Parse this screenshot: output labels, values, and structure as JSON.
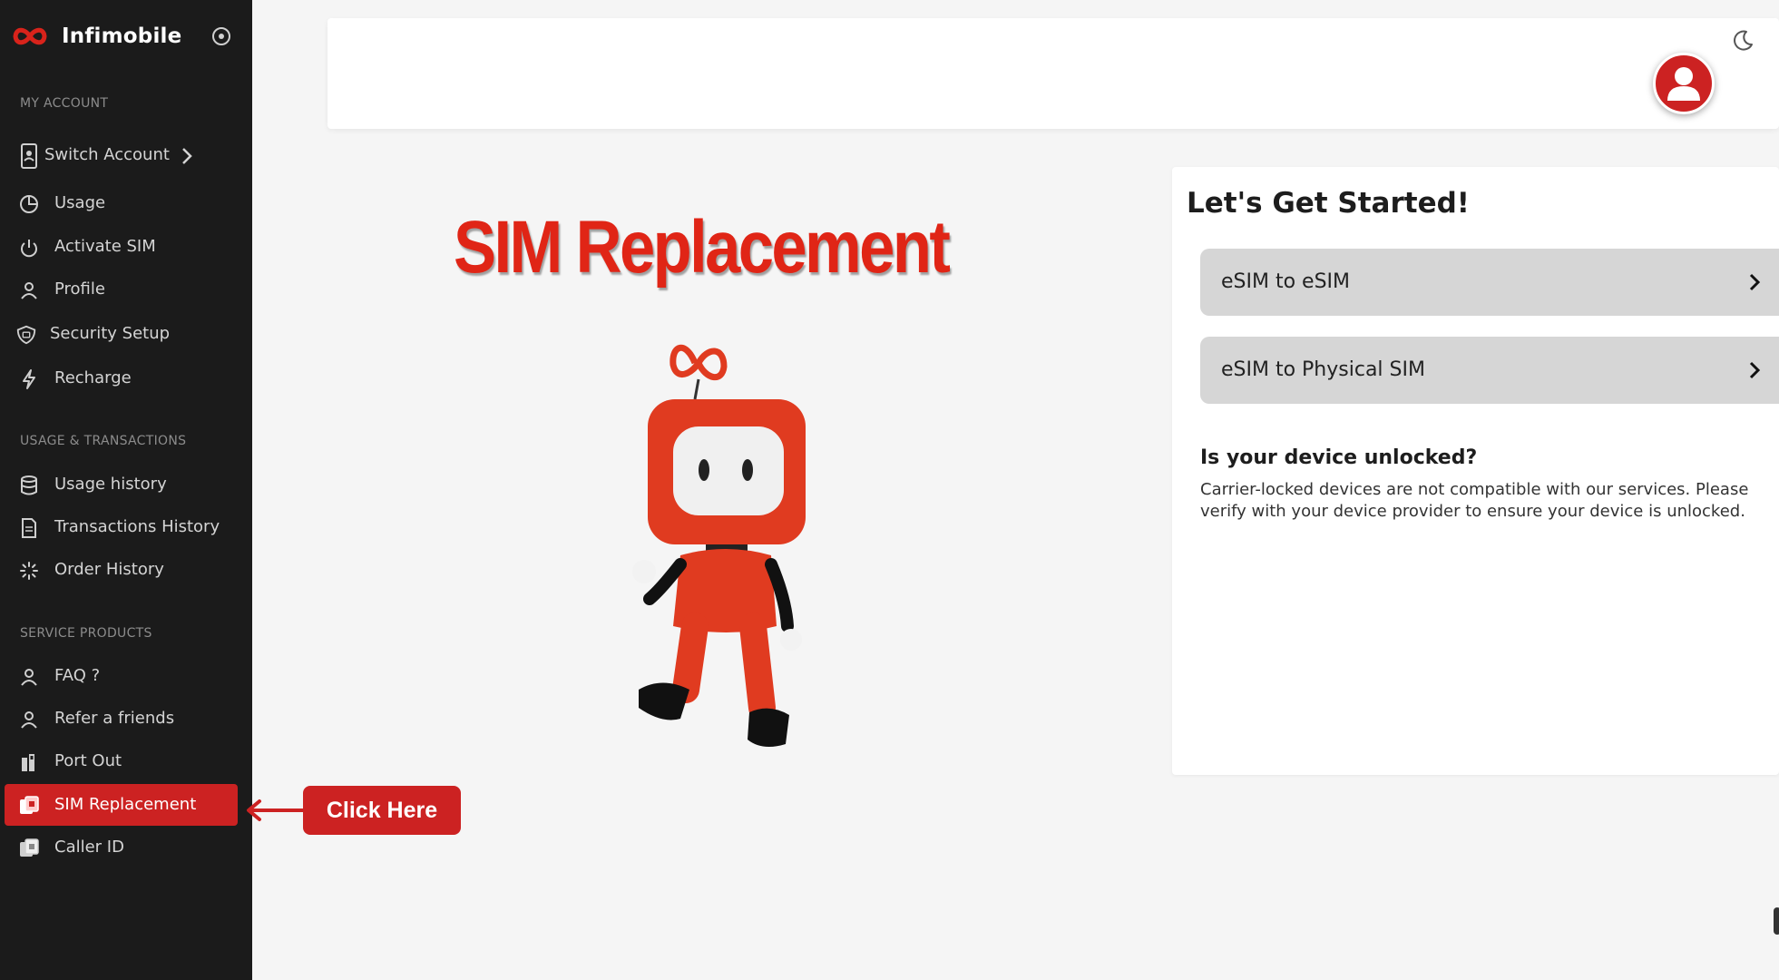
{
  "brand": {
    "name": "Infimobile"
  },
  "sidebar": {
    "sections": {
      "my_account": "MY ACCOUNT",
      "usage_transactions": "USAGE & TRANSACTIONS",
      "service_products": "SERVICE PRODUCTS"
    },
    "switch_account": "Switch Account",
    "items": {
      "usage": "Usage",
      "activate_sim": "Activate SIM",
      "profile": "Profile",
      "security_setup": "Security Setup",
      "recharge": "Recharge",
      "usage_history": "Usage history",
      "transactions_history": "Transactions History",
      "order_history": "Order History",
      "faq": "FAQ ?",
      "refer": "Refer a friends",
      "port_out": "Port Out",
      "sim_replacement": "SIM Replacement",
      "caller_id": "Caller ID"
    },
    "active_item": "SIM Replacement"
  },
  "hero": {
    "title": "SIM Replacement"
  },
  "card": {
    "title": "Let's Get Started!",
    "options": [
      "eSIM to eSIM",
      "eSIM to Physical SIM"
    ],
    "question_title": "Is your device unlocked?",
    "question_text": "Carrier-locked devices are not compatible with our services. Please verify with your device provider to ensure your device is unlocked."
  },
  "callout": {
    "label": "Click Here"
  },
  "colors": {
    "accent": "#cc2222",
    "sidebar_bg": "#1b1b1b",
    "page_bg": "#f5f5f5",
    "option_bg": "#d6d6d6"
  }
}
